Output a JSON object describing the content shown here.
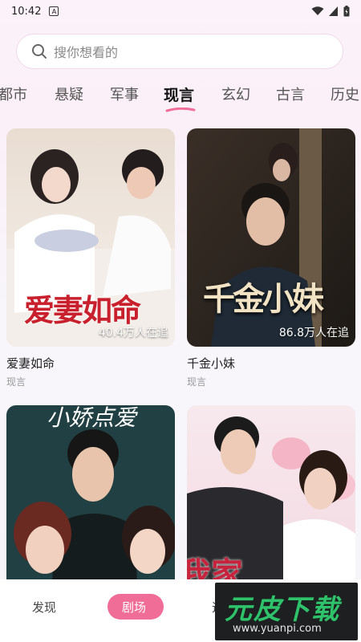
{
  "status_bar": {
    "time": "10:42",
    "app_icon_glyph": "A"
  },
  "search": {
    "placeholder": "搜你想看的"
  },
  "tabs": [
    {
      "label": "都市"
    },
    {
      "label": "悬疑"
    },
    {
      "label": "军事"
    },
    {
      "label": "现言",
      "active": true
    },
    {
      "label": "玄幻"
    },
    {
      "label": "古言"
    },
    {
      "label": "历史"
    }
  ],
  "cards": [
    {
      "poster_title": "爱妻如命",
      "viewers": "40.4万人在追",
      "title": "爱妻如命",
      "genre": "现言"
    },
    {
      "poster_title": "千金小妹",
      "viewers": "86.8万人在追",
      "title": "千金小妹",
      "genre": "现言"
    },
    {
      "poster_title": "小娇点爱"
    },
    {
      "poster_title": "我家"
    }
  ],
  "bottom_nav": {
    "items": [
      {
        "label": "发现"
      },
      {
        "label": "剧场",
        "active": true
      },
      {
        "label": "追"
      }
    ]
  },
  "watermark": {
    "title": "元皮下载",
    "url": "www.yuanpi.com"
  },
  "colors": {
    "accent": "#f06d98",
    "watermark_green": "#2ec36a"
  }
}
